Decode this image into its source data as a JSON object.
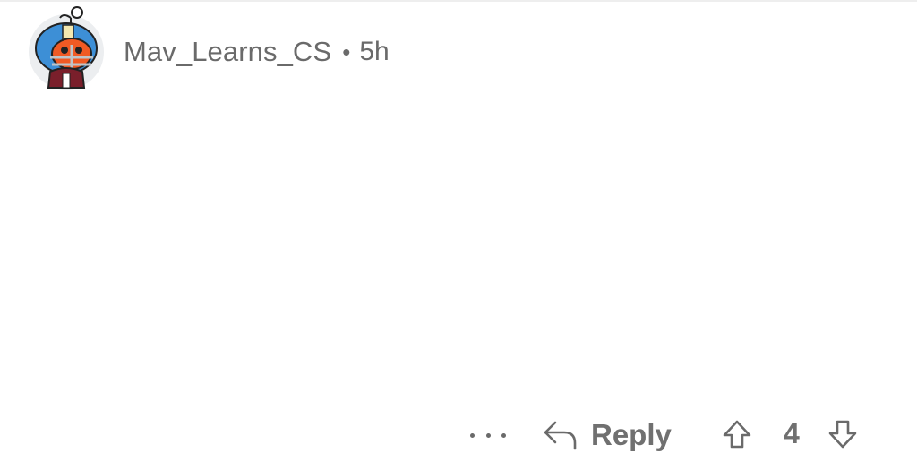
{
  "comment": {
    "username": "Mav_Learns_CS",
    "separator": "•",
    "time_ago": "5h",
    "avatar_icon": "snoo-football-helmet-avatar"
  },
  "actions": {
    "more_icon": "ellipsis-icon",
    "reply_icon": "reply-arrow-icon",
    "reply_label": "Reply",
    "upvote_icon": "upvote-arrow-icon",
    "score": "4",
    "downvote_icon": "downvote-arrow-icon"
  },
  "colors": {
    "text": "#6a6a6a",
    "avatar_bg": "#eceef0",
    "helmet_blue": "#3d8fd6",
    "face_orange": "#f05a24",
    "jersey_maroon": "#7a1f2b"
  }
}
